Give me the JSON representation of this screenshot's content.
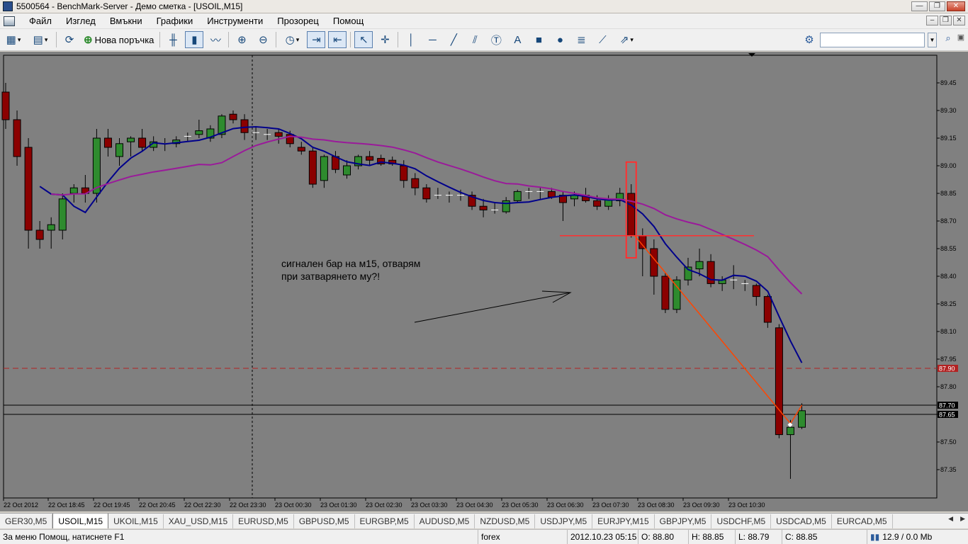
{
  "window": {
    "title": "5500564 - BenchMark-Server - Демо сметка - [USOIL,M15]"
  },
  "menu": {
    "items": [
      "Файл",
      "Изглед",
      "Вмъкни",
      "Графики",
      "Инструменти",
      "Прозорец",
      "Помощ"
    ]
  },
  "toolbar": {
    "new_order_label": "Нова поръчка"
  },
  "search": {
    "placeholder": "",
    "value": ""
  },
  "chart": {
    "annotation": [
      "сигнален бар на м15, отварям",
      "при затварянето му?!"
    ],
    "price_tag_red": "87.90",
    "price_tag_black_1": "87.70",
    "price_tag_black_2": "87.65"
  },
  "chart_data": {
    "type": "candlestick",
    "symbol": "USOIL",
    "timeframe": "M15",
    "ylim": [
      87.2,
      89.55
    ],
    "yticks": [
      "89.45",
      "89.30",
      "89.15",
      "89.00",
      "88.85",
      "88.70",
      "88.55",
      "88.40",
      "88.25",
      "88.10",
      "87.95",
      "87.80",
      "87.65",
      "87.50",
      "87.35"
    ],
    "xticks": [
      "22 Oct 2012",
      "22 Oct 18:45",
      "22 Oct 19:45",
      "22 Oct 20:45",
      "22 Oct 22:30",
      "22 Oct 23:30",
      "23 Oct 00:30",
      "23 Oct 01:30",
      "23 Oct 02:30",
      "23 Oct 03:30",
      "23 Oct 04:30",
      "23 Oct 05:30",
      "23 Oct 06:30",
      "23 Oct 07:30",
      "23 Oct 08:30",
      "23 Oct 09:30",
      "23 Oct 10:30"
    ],
    "ohlc": [
      [
        89.4,
        89.45,
        89.2,
        89.25
      ],
      [
        89.25,
        89.3,
        89.0,
        89.05
      ],
      [
        89.1,
        89.15,
        88.55,
        88.65
      ],
      [
        88.65,
        88.7,
        88.55,
        88.6
      ],
      [
        88.65,
        88.72,
        88.55,
        88.68
      ],
      [
        88.65,
        88.85,
        88.6,
        88.82
      ],
      [
        88.85,
        88.9,
        88.8,
        88.88
      ],
      [
        88.88,
        88.95,
        88.8,
        88.85
      ],
      [
        88.85,
        89.2,
        88.8,
        89.15
      ],
      [
        89.15,
        89.2,
        89.05,
        89.1
      ],
      [
        89.05,
        89.15,
        89.0,
        89.12
      ],
      [
        89.13,
        89.16,
        89.05,
        89.15
      ],
      [
        89.15,
        89.2,
        89.08,
        89.1
      ],
      [
        89.1,
        89.16,
        89.08,
        89.13
      ],
      [
        89.12,
        89.15,
        89.08,
        89.11
      ],
      [
        89.12,
        89.16,
        89.1,
        89.14
      ],
      [
        89.15,
        89.18,
        89.13,
        89.16
      ],
      [
        89.17,
        89.25,
        89.15,
        89.19
      ],
      [
        89.15,
        89.22,
        89.13,
        89.2
      ],
      [
        89.17,
        89.28,
        89.15,
        89.27
      ],
      [
        89.28,
        89.3,
        89.23,
        89.25
      ],
      [
        89.25,
        89.28,
        89.14,
        89.18
      ],
      [
        89.18,
        89.21,
        89.14,
        89.18
      ],
      [
        89.17,
        89.2,
        89.14,
        89.16
      ],
      [
        89.18,
        89.2,
        89.12,
        89.16
      ],
      [
        89.17,
        89.19,
        89.1,
        89.12
      ],
      [
        89.1,
        89.13,
        89.06,
        89.08
      ],
      [
        89.08,
        89.1,
        88.88,
        88.9
      ],
      [
        88.92,
        89.06,
        88.88,
        89.05
      ],
      [
        89.05,
        89.08,
        88.96,
        88.98
      ],
      [
        88.95,
        89.03,
        88.93,
        89.0
      ],
      [
        89.0,
        89.06,
        88.98,
        89.05
      ],
      [
        89.05,
        89.08,
        89.0,
        89.03
      ],
      [
        89.04,
        89.06,
        89.0,
        89.01
      ],
      [
        89.03,
        89.05,
        89.0,
        89.01
      ],
      [
        89.0,
        89.03,
        88.88,
        88.92
      ],
      [
        88.93,
        88.96,
        88.84,
        88.88
      ],
      [
        88.88,
        88.9,
        88.8,
        88.82
      ],
      [
        88.84,
        88.88,
        88.82,
        88.84
      ],
      [
        88.84,
        88.86,
        88.8,
        88.83
      ],
      [
        88.84,
        88.87,
        88.81,
        88.84
      ],
      [
        88.84,
        88.86,
        88.76,
        88.78
      ],
      [
        88.78,
        88.82,
        88.72,
        88.76
      ],
      [
        88.76,
        88.8,
        88.74,
        88.75
      ],
      [
        88.75,
        88.83,
        88.74,
        88.81
      ],
      [
        88.81,
        88.87,
        88.8,
        88.86
      ],
      [
        88.85,
        88.88,
        88.82,
        88.86
      ],
      [
        88.86,
        88.88,
        88.82,
        88.86
      ],
      [
        88.86,
        88.88,
        88.82,
        88.83
      ],
      [
        88.84,
        88.86,
        88.7,
        88.8
      ],
      [
        88.82,
        88.86,
        88.78,
        88.84
      ],
      [
        88.84,
        88.88,
        88.8,
        88.81
      ],
      [
        88.81,
        88.84,
        88.76,
        88.78
      ],
      [
        88.78,
        88.84,
        88.76,
        88.82
      ],
      [
        88.81,
        88.88,
        88.78,
        88.85
      ],
      [
        88.85,
        88.9,
        88.61,
        88.62
      ],
      [
        88.62,
        88.66,
        88.4,
        88.55
      ],
      [
        88.55,
        88.6,
        88.3,
        88.4
      ],
      [
        88.4,
        88.42,
        88.2,
        88.22
      ],
      [
        88.22,
        88.4,
        88.2,
        88.38
      ],
      [
        88.38,
        88.5,
        88.35,
        88.45
      ],
      [
        88.44,
        88.55,
        88.4,
        88.48
      ],
      [
        88.48,
        88.52,
        88.34,
        88.36
      ],
      [
        88.36,
        88.4,
        88.32,
        88.38
      ],
      [
        88.38,
        88.46,
        88.33,
        88.38
      ],
      [
        88.36,
        88.38,
        88.32,
        88.35
      ],
      [
        88.35,
        88.36,
        88.24,
        88.29
      ],
      [
        88.29,
        88.3,
        88.12,
        88.15
      ],
      [
        88.12,
        88.14,
        87.52,
        87.54
      ],
      [
        87.54,
        87.62,
        87.3,
        87.58
      ],
      [
        87.58,
        87.71,
        87.57,
        87.67
      ]
    ],
    "ma_fast_color": "#00008b",
    "ma_slow_color": "#9a1a9a",
    "levels": [
      {
        "price": 87.9,
        "style": "dashed",
        "color": "#b22222"
      },
      {
        "price": 87.7,
        "style": "solid",
        "color": "#000000"
      },
      {
        "price": 87.65,
        "style": "solid",
        "color": "#000000"
      }
    ],
    "colors": {
      "bull": "#2e8b2e",
      "bear": "#8b0000",
      "background": "#808080",
      "grid": "#000000"
    }
  },
  "tabs": [
    "GER30,M5",
    "USOIL,M15",
    "UKOIL,M15",
    "XAU_USD,M15",
    "EURUSD,M5",
    "GBPUSD,M5",
    "EURGBP,M5",
    "AUDUSD,M5",
    "NZDUSD,M5",
    "USDJPY,M5",
    "EURJPY,M15",
    "GBPJPY,M5",
    "USDCHF,M5",
    "USDCAD,M5",
    "EURCAD,M5"
  ],
  "status": {
    "help": "За меню Помощ, натиснете F1",
    "profile": "forex",
    "time": "2012.10.23 05:15",
    "open": "O: 88.80",
    "high": "H: 88.85",
    "low": "L: 88.79",
    "close": "C: 88.85",
    "traffic": "12.9 / 0.0 Mb"
  }
}
